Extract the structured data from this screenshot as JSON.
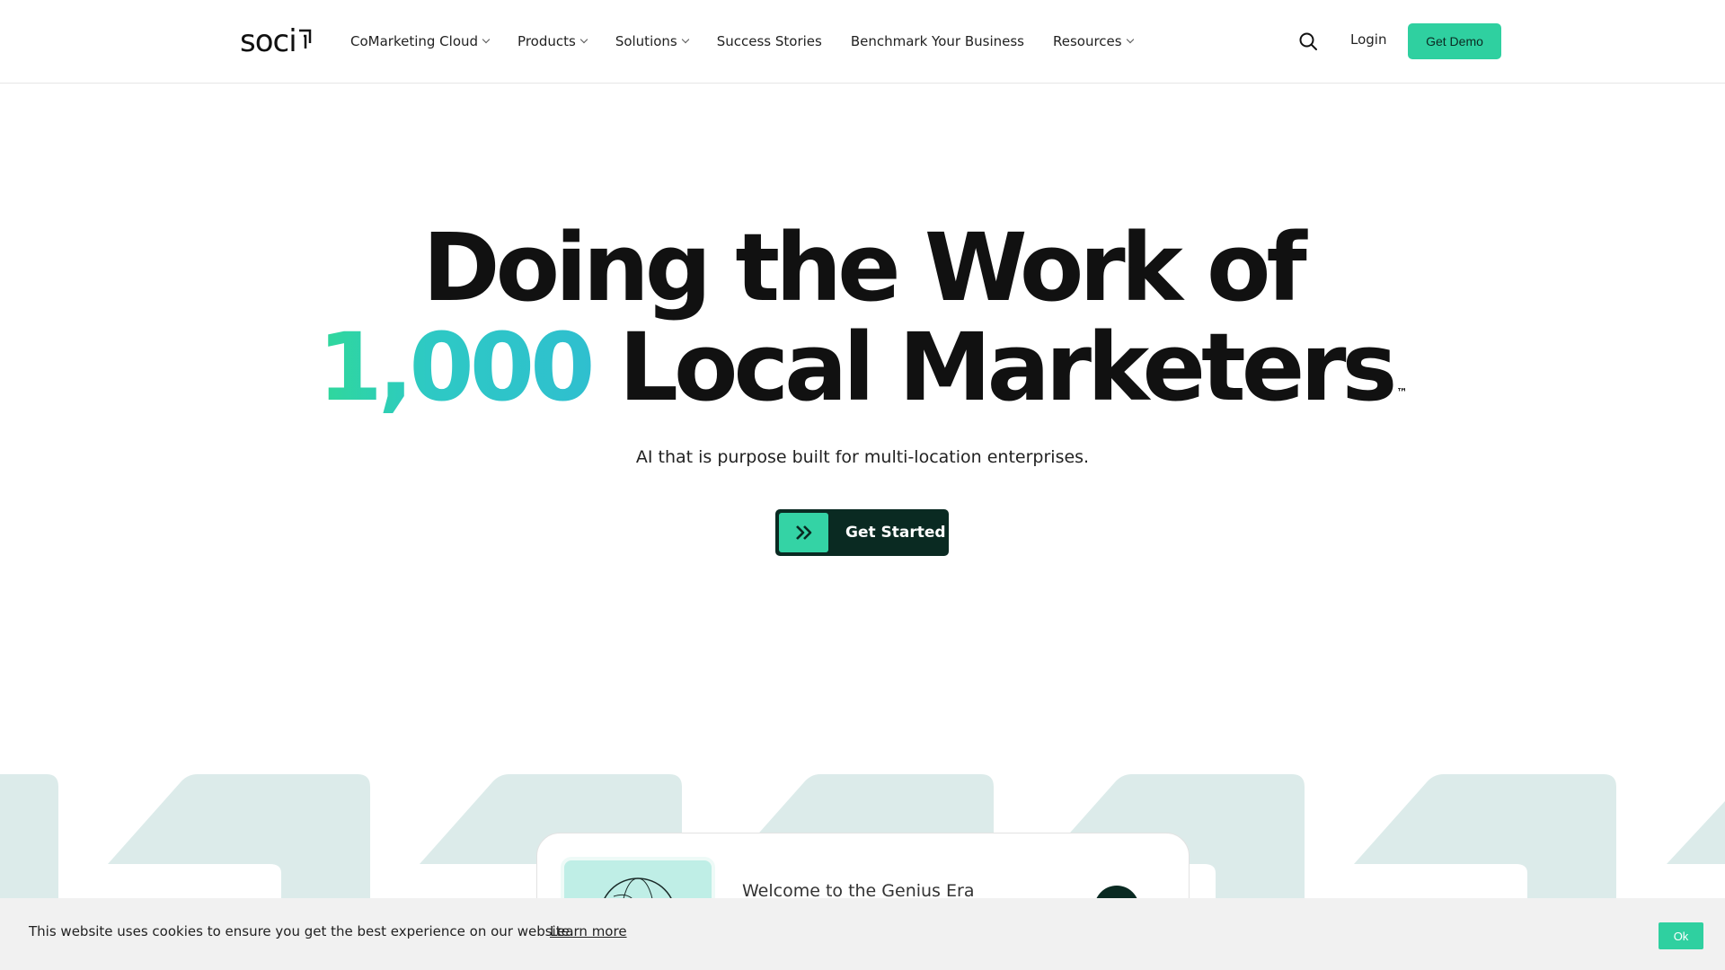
{
  "header": {
    "logo_text": "soci",
    "nav": [
      {
        "label": "CoMarketing Cloud",
        "dropdown": true
      },
      {
        "label": "Products",
        "dropdown": true
      },
      {
        "label": "Solutions",
        "dropdown": true
      },
      {
        "label": "Success Stories",
        "dropdown": false
      },
      {
        "label": "Benchmark Your Business",
        "dropdown": false
      },
      {
        "label": "Resources",
        "dropdown": true
      }
    ],
    "login_label": "Login",
    "demo_label": "Get Demo"
  },
  "hero": {
    "line1": "Doing the Work of",
    "accent": "1,000",
    "line2_rest": "Local Marketers",
    "trademark": "™",
    "subhead": "AI that is purpose built for multi-location enterprises.",
    "cta_label": "Get Started"
  },
  "card": {
    "title": "Welcome to the Genius Era"
  },
  "cookie": {
    "text": "This website uses cookies to ensure you get the best experience on our website.",
    "link": "Learn more",
    "ok": "Ok"
  },
  "colors": {
    "accent_green": "#2fd0a0",
    "dark_green": "#0a2a22",
    "band_tile": "#dcebea"
  },
  "icons": {
    "search": "search-icon",
    "cta": "double-chevron-right-icon",
    "dropdown": "chevron-down-icon"
  }
}
